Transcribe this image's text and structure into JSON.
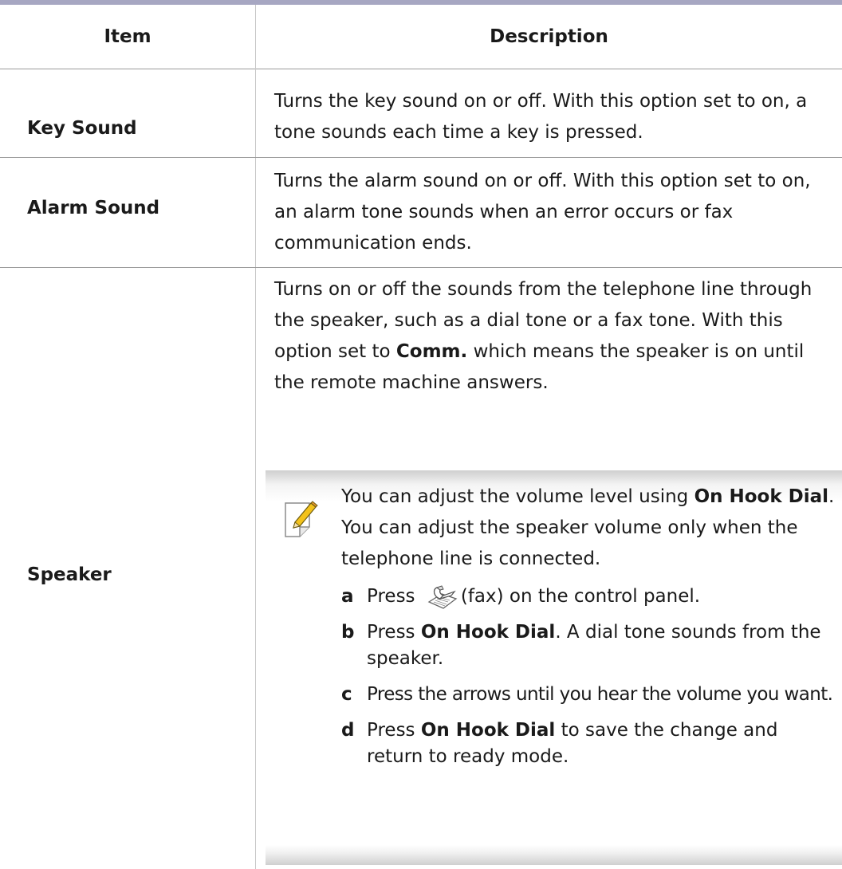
{
  "table": {
    "headers": {
      "item": "Item",
      "description": "Description"
    },
    "rows": [
      {
        "item": "Key Sound",
        "description": "Turns the key sound on or off. With this option set to on, a tone sounds each time a key is pressed."
      },
      {
        "item": "Alarm Sound",
        "description": "Turns the alarm sound on or off. With this option set to on, an alarm tone sounds when an error occurs or fax communication ends."
      },
      {
        "item": "Speaker",
        "description_pre": "Turns on or off the sounds from the telephone line through the speaker, such as a dial tone or a fax tone. With this option set to ",
        "description_bold": "Comm.",
        "description_post": " which means the speaker is on until the remote machine answers."
      }
    ]
  },
  "note": {
    "icon": "note-pencil-icon",
    "pre": "You can adjust the volume level using ",
    "bold": "On Hook Dial",
    "post": ". You can adjust the speaker volume only when the telephone line is connected.",
    "steps": [
      {
        "letter": "a",
        "pre": "Press ",
        "icon": "fax-icon",
        "post": "(fax) on the control panel."
      },
      {
        "letter": "b",
        "pre": "Press ",
        "bold": "On Hook Dial",
        "post": ". A dial tone sounds from the speaker."
      },
      {
        "letter": "c",
        "pre": "Press the arrows until you hear the volume you want."
      },
      {
        "letter": "d",
        "pre": "Press ",
        "bold": "On Hook Dial",
        "post": " to save the change and return to ready mode."
      }
    ]
  }
}
